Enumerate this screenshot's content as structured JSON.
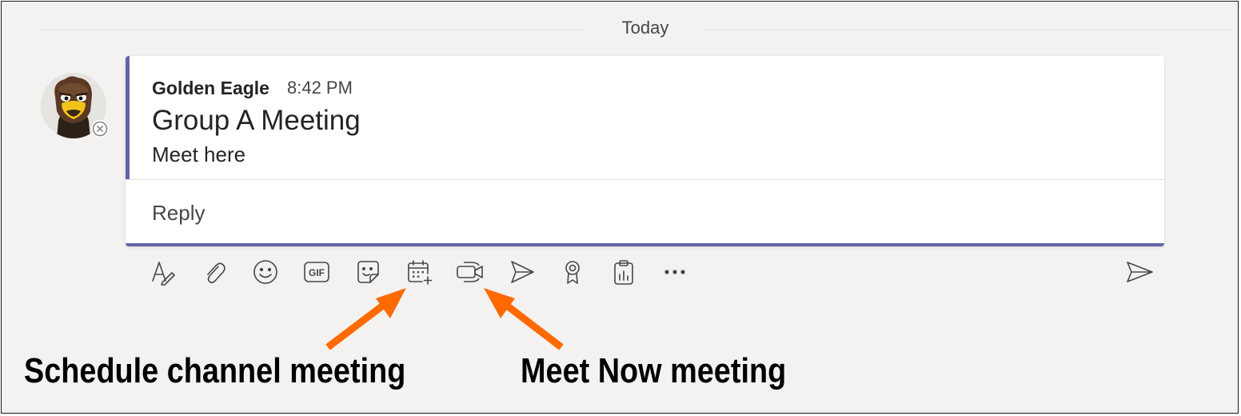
{
  "divider": {
    "label": "Today"
  },
  "message": {
    "author": "Golden Eagle",
    "time": "8:42 PM",
    "subject": "Group A Meeting",
    "body": "Meet here",
    "reply_label": "Reply",
    "presence": "offline"
  },
  "toolbar": {
    "icons": [
      "format-icon",
      "attach-icon",
      "emoji-icon",
      "gif-icon",
      "sticker-icon",
      "schedule-meeting-icon",
      "meet-now-icon",
      "stream-icon",
      "praise-icon",
      "forms-icon",
      "more-options-icon",
      "send-icon"
    ],
    "gif_label": "GIF"
  },
  "annotations": {
    "schedule_label": "Schedule channel meeting",
    "meet_now_label": "Meet Now meeting",
    "arrow_color": "#ff6a00"
  },
  "colors": {
    "accent": "#6264a7",
    "background": "#f3f2f1"
  }
}
